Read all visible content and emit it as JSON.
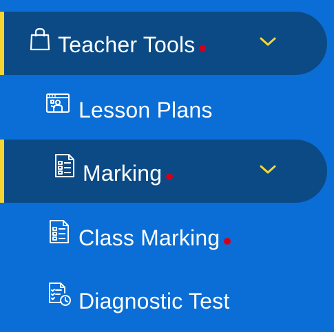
{
  "colors": {
    "background": "#0a6ed6",
    "active_bg": "#0b4a85",
    "accent_bar": "#f7d531",
    "chevron": "#f7d531",
    "badge_dot": "#d0021b",
    "text": "#ffffff"
  },
  "menu": {
    "teacher_tools": {
      "label": "Teacher Tools",
      "icon": "shopping-bag-icon",
      "has_badge": true,
      "expanded": true
    },
    "lesson_plans": {
      "label": "Lesson Plans",
      "icon": "presentation-board-icon"
    },
    "marking": {
      "label": "Marking",
      "icon": "document-list-icon",
      "has_badge": true,
      "expanded": true
    },
    "class_marking": {
      "label": "Class Marking",
      "icon": "document-list-icon",
      "has_badge": true
    },
    "diagnostic_test": {
      "label": "Diagnostic Test",
      "icon": "checklist-clock-icon"
    }
  }
}
